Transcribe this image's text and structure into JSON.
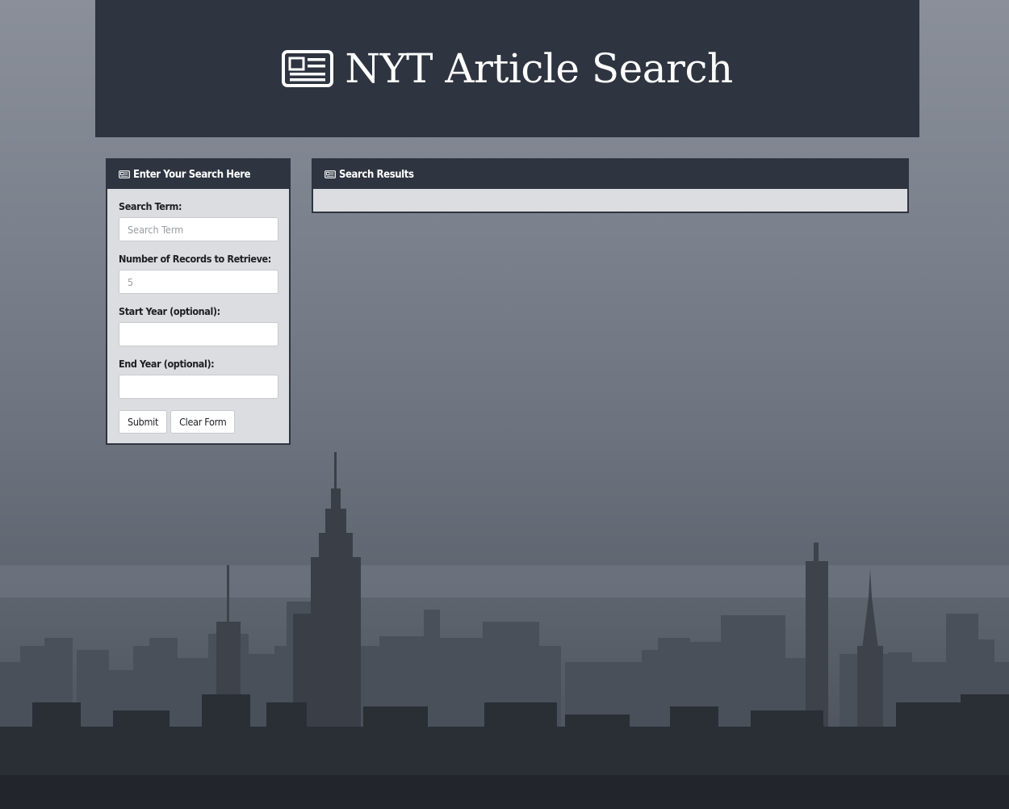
{
  "header": {
    "title": "NYT Article Search",
    "icon": "newspaper-icon"
  },
  "search_panel": {
    "heading": "Enter Your Search Here",
    "heading_icon": "newspaper-icon",
    "fields": {
      "search_term": {
        "label": "Search Term:",
        "placeholder": "Search Term",
        "value": ""
      },
      "num_records": {
        "label": "Number of Records to Retrieve:",
        "placeholder": "5",
        "value": ""
      },
      "start_year": {
        "label": "Start Year (optional):",
        "value": ""
      },
      "end_year": {
        "label": "End Year (optional):",
        "value": ""
      }
    },
    "submit_label": "Submit",
    "clear_label": "Clear Form"
  },
  "results_panel": {
    "heading": "Search Results",
    "heading_icon": "newspaper-icon"
  },
  "colors": {
    "header_bg": "#2e3440",
    "panel_body_bg": "#dcdde0",
    "background_sky": "#7b818c"
  }
}
